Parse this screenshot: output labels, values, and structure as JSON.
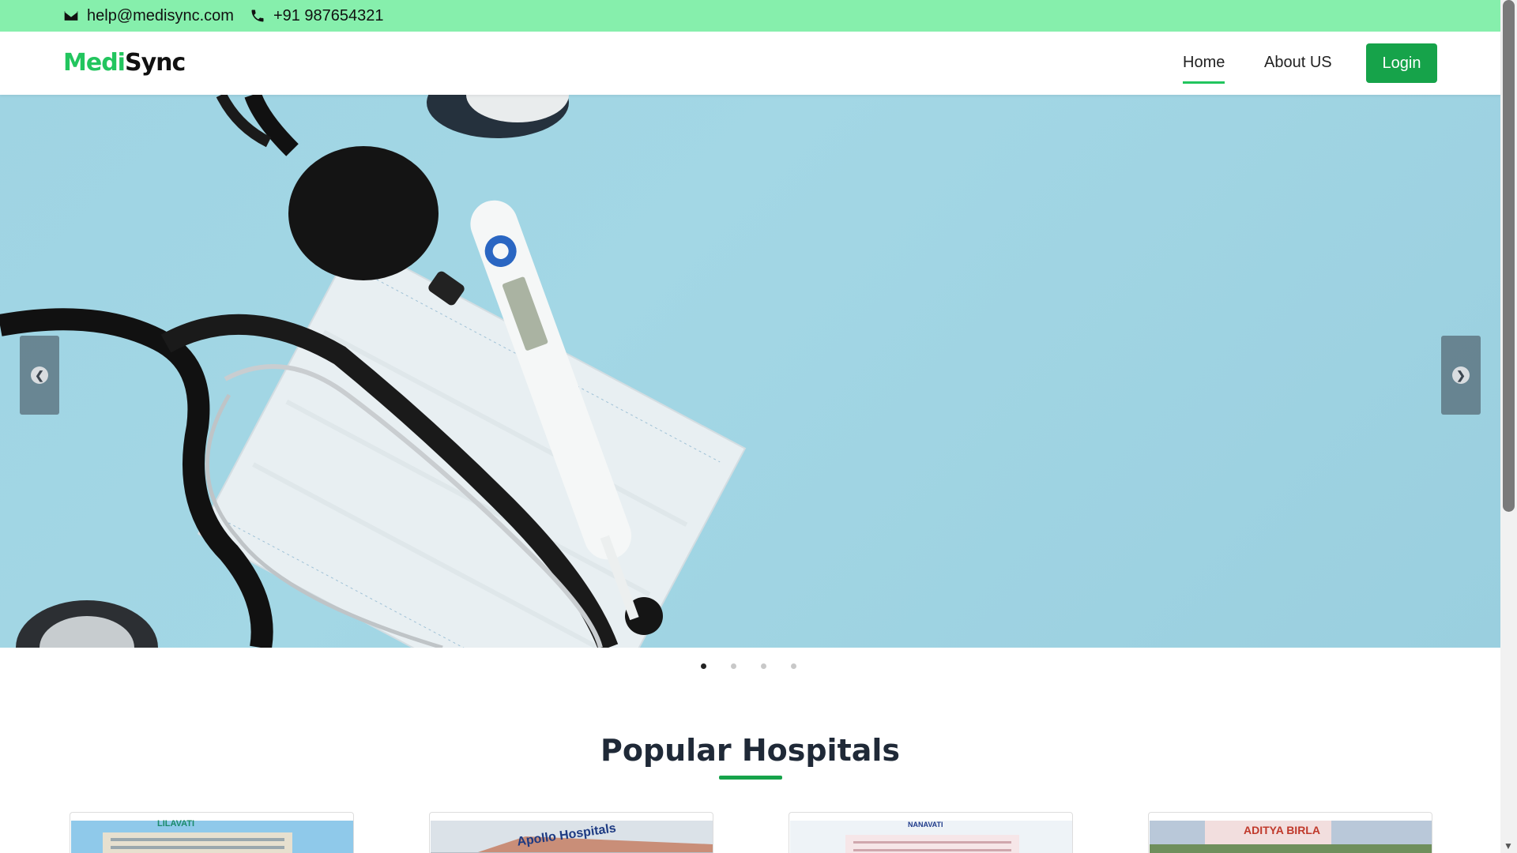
{
  "topbar": {
    "email": "help@medisync.com",
    "phone": "+91 987654321"
  },
  "navbar": {
    "brand_part1": "Medi",
    "brand_part2": "Sync",
    "links": [
      {
        "label": "Home",
        "active": true
      },
      {
        "label": "About US",
        "active": false
      }
    ],
    "login_label": "Login"
  },
  "carousel": {
    "slide_count": 4,
    "active_slide": 1,
    "prev_icon": "chevron-left-icon",
    "next_icon": "chevron-right-icon"
  },
  "section": {
    "title": "Popular Hospitals"
  },
  "hospitals": [
    {
      "sign": "LILAVATI"
    },
    {
      "sign": "Apollo Hospitals"
    },
    {
      "sign": "NANAVATI"
    },
    {
      "sign": "ADITYA BIRLA"
    }
  ],
  "colors": {
    "accent": "#16a34a",
    "topbar": "#86efac",
    "brand_green": "#22c55e"
  }
}
